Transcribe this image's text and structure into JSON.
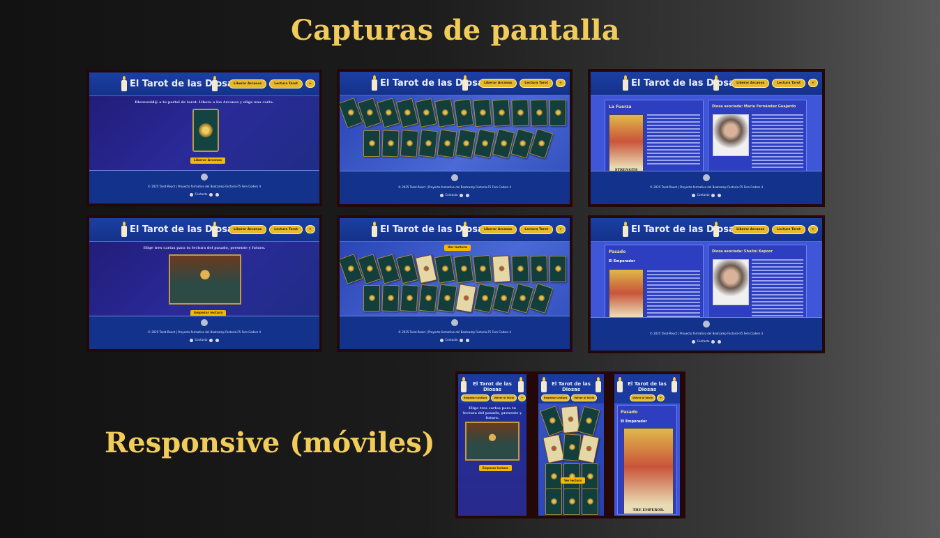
{
  "page": {
    "title": "Capturas de pantalla",
    "responsive_title": "Responsive (móviles)"
  },
  "app": {
    "brand": "El Tarot de las Diosas",
    "brand_mobile": "El Tarot de las Diosas",
    "nav": {
      "liberar": "Liberar Arcanos",
      "lectura": "Lectura Tarot",
      "extra": "+"
    },
    "footer": {
      "copy": "© 2025 Tarot-React | Proyecto formativo del Bootcamp Factoría-F5 Fem Coders 4",
      "contact": "Contacto"
    }
  },
  "screens": {
    "home": {
      "welcome": "Bienvenid@ a tu portal de tarot. Libera a los Arcanos y elige una carta.",
      "button": "Liberar Arcanos"
    },
    "reading": {
      "instruction": "Elige tres cartas para tu lectura del pasado, presente y futuro.",
      "button": "Empezar lectura"
    },
    "selection": {
      "button": "Ver lectura"
    },
    "detail1": {
      "card_title": "La Fuerza",
      "card_name": "STRENGTH",
      "goddess": "Diosa asociada: María Fernández Guajardo"
    },
    "detail2": {
      "section": "Pasado",
      "card_title": "El Emperador",
      "goddess": "Diosa asociada: Shalini Kapoor"
    },
    "mobile1": {
      "btn1": "Empezar Lectura",
      "btn2": "Volver al inicio",
      "instruction": "Elige tres cartas para tu lectura del pasado, presente y futuro.",
      "button": "Empezar lectura"
    },
    "mobile2": {
      "btn1": "Empezar Lectura",
      "btn2": "Volver al inicio",
      "button": "Ver lectura"
    },
    "mobile3": {
      "btn1": "Volver al inicio",
      "section": "Pasado",
      "card_title": "El Emperador",
      "card_name": "THE EMPEROR."
    }
  }
}
